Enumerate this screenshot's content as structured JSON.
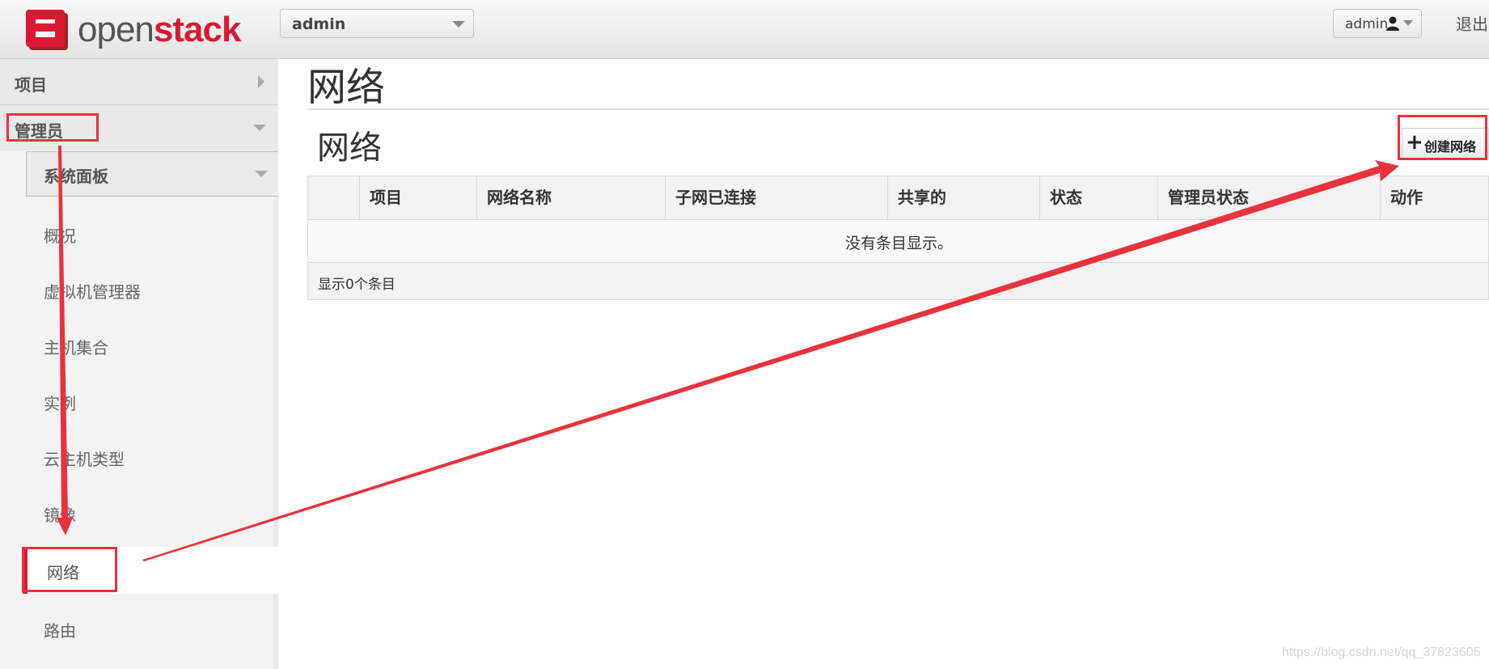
{
  "header": {
    "logo_text_open": "open",
    "logo_text_stack": "stack",
    "project_selector": "admin",
    "user_menu": "admin",
    "user_icon": "user-icon",
    "sign_out": "退出"
  },
  "sidebar": {
    "project_label": "项目",
    "admin_label": "管理员",
    "system_panel_label": "系统面板",
    "items": [
      {
        "label": "概况"
      },
      {
        "label": "虚拟机管理器"
      },
      {
        "label": "主机集合"
      },
      {
        "label": "实例"
      },
      {
        "label": "云主机类型"
      },
      {
        "label": "镜像"
      },
      {
        "label": "网络",
        "active": true
      },
      {
        "label": "路由"
      }
    ]
  },
  "main": {
    "page_title": "网络",
    "table_title": "网络",
    "create_button": "创建网络",
    "columns": [
      "项目",
      "网络名称",
      "子网已连接",
      "共享的",
      "状态",
      "管理员状态",
      "动作"
    ],
    "empty_message": "没有条目显示。",
    "footer": "显示0个条目"
  },
  "watermark": "https://blog.csdn.net/qq_37823605",
  "colors": {
    "accent": "#da1a32",
    "annotation": "#e8323c"
  }
}
